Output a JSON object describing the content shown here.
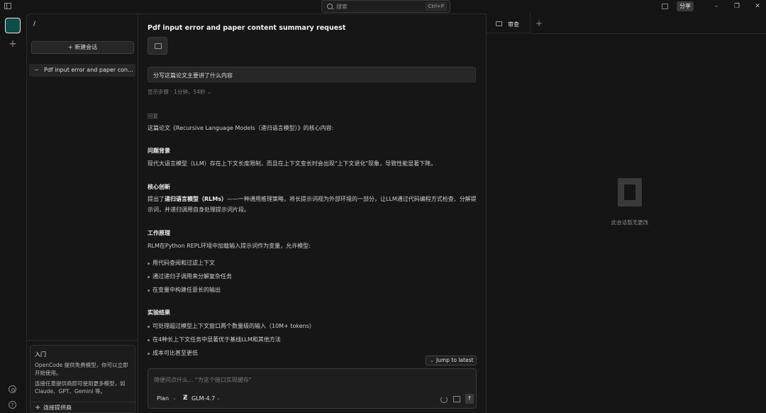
{
  "topbar": {
    "search_placeholder": "搜索",
    "search_shortcut": "Ctrl+P",
    "share_label": "分享",
    "minimize_glyph": "–",
    "maximize_glyph": "❐",
    "close_glyph": "✕"
  },
  "rail": {
    "add_glyph": "+",
    "help_glyph": "?"
  },
  "sidebar": {
    "path": "/",
    "new_session_label": "+ 新建会话",
    "sessions": [
      {
        "label": "Pdf input error and paper con..."
      }
    ],
    "intro": {
      "title": "入门",
      "text1": "OpenCode 提供免费模型，你可以立即开始使用。",
      "text2": "连接任意提供商即可使用更多模型，如 Claude、GPT、Gemini 等。",
      "connect_glyph": "+",
      "connect_label": "连接提供商"
    }
  },
  "chat": {
    "title": "Pdf input error and paper content summary request",
    "user_message": "分写这篇论文主要讲了什么内容",
    "steps_line": "显示步骤 · 1分钟、54秒 ⌄",
    "reply_label": "回复",
    "intro": "这篇论文《Recursive Language Models（递归语言模型）》的核心内容:",
    "sections": [
      {
        "heading": "问题背景",
        "paragraph": "现代大语言模型（LLM）存在上下文长度限制，而且在上下文变长时会出现\"上下文退化\"现象，导致性能显著下降。"
      },
      {
        "heading": "核心创新",
        "paragraph_lead": "提出了",
        "paragraph_bold": "递归语言模型（RLMs）",
        "paragraph_rest": "——一种通用推理策略，将长提示词视为外部环境的一部分，让LLM通过代码编程方式检查、分解提示词，并递归调用自身处理提示词片段。"
      },
      {
        "heading": "工作原理",
        "paragraph": "RLM在Python REPL环境中加载输入提示词作为变量，允许模型:",
        "bullets": [
          "用代码查阅和过滤上下文",
          "通过递归子调用来分解复杂任务",
          "在变量中构建任意长的输出"
        ]
      },
      {
        "heading": "实验结果",
        "bullets": [
          "可处理超过模型上下文窗口两个数量级的输入（10M+ tokens）",
          "在4种长上下文任务中显著优于基线LLM和其他方法",
          "成本可比甚至更低"
        ]
      }
    ],
    "jump_chevron": "⌄",
    "jump_label": "Jump to latest",
    "composer": {
      "placeholder": "随便问点什么... \"为这个接口实现缓存\"",
      "agent": "Plan",
      "agent_chevron": "⌄",
      "model_glyph": "Ƶ",
      "model": "GLM-4.7",
      "model_chevron": "⌄",
      "send_glyph": "↑"
    }
  },
  "right_panel": {
    "tab_label": "审查",
    "add_tab_glyph": "+",
    "empty_text": "此会话暂无更改"
  }
}
